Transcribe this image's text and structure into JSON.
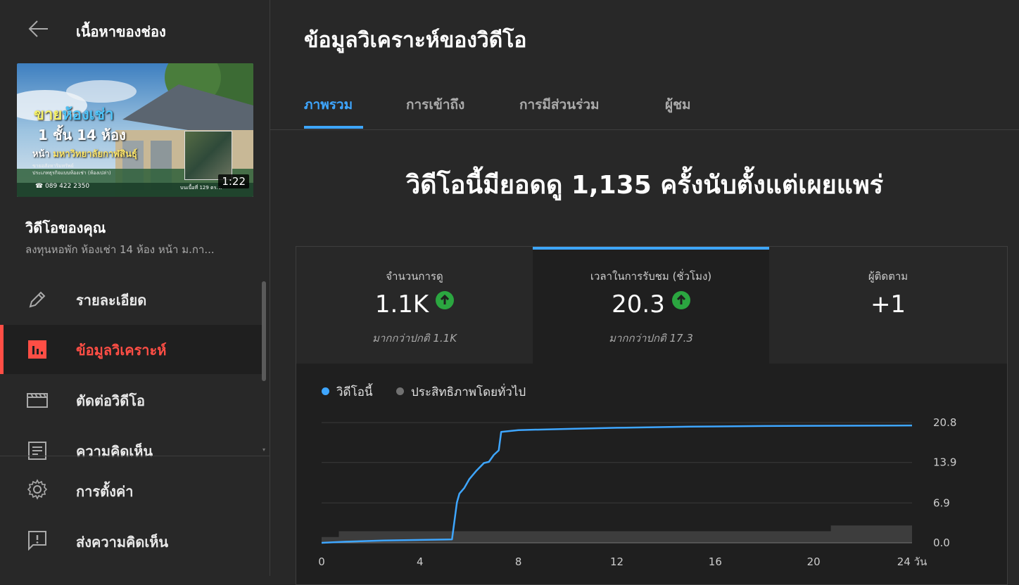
{
  "sidebar": {
    "title": "เนื้อหาของช่อง",
    "thumbnail": {
      "line1_a": "ขาย",
      "line1_b": "ห้องเช่า",
      "line2": "1 ชั้น 14 ห้อง",
      "line3_a": "หน้า ",
      "line3_b": "มหาวิทยาลัยกาฬสินธุ์",
      "small1": "ขายอสังหาริมทรัพย์",
      "small2": "ประเภทธุรกิจแบบห้องเช่า (ห้องเปล่า)",
      "phone": "☎ 089 422 2350",
      "map_label": "บนเนื้อที่ 129 ตร.ว.",
      "duration": "1:22"
    },
    "your_video": "วิดีโอของคุณ",
    "video_name": "ลงทุนหอพัก ห้องเช่า 14 ห้อง หน้า ม.กา...",
    "nav": [
      {
        "label": "รายละเอียด",
        "icon": "pencil-icon"
      },
      {
        "label": "ข้อมูลวิเคราะห์",
        "icon": "analytics-icon"
      },
      {
        "label": "ตัดต่อวิดีโอ",
        "icon": "editor-icon"
      },
      {
        "label": "ความคิดเห็น",
        "icon": "comments-icon"
      }
    ],
    "bottom": [
      {
        "label": "การตั้งค่า",
        "icon": "gear-icon"
      },
      {
        "label": "ส่งความคิดเห็น",
        "icon": "feedback-icon"
      }
    ]
  },
  "main": {
    "title": "ข้อมูลวิเคราะห์ของวิดีโอ",
    "tabs": [
      "ภาพรวม",
      "การเข้าถึง",
      "การมีส่วนร่วม",
      "ผู้ชม"
    ],
    "headline": "วิดีโอนี้มียอดดู 1,135 ครั้งนับตั้งแต่เผยแพร่",
    "metrics": [
      {
        "label": "จำนวนการดู",
        "value": "1.1K",
        "note": "มากกว่าปกติ 1.1K"
      },
      {
        "label": "เวลาในการรับชม (ชั่วโมง)",
        "value": "20.3",
        "note": "มากกว่าปกติ 17.3"
      },
      {
        "label": "ผู้ติดตาม",
        "value": "+1",
        "note": ""
      }
    ],
    "legend": {
      "this_video": "วิดีโอนี้",
      "typical": "ประสิทธิภาพโดยทั่วไป"
    },
    "colors": {
      "accent": "#3ea6ff",
      "active_nav": "#ff4e45",
      "up": "#2ba640",
      "series": "#3ea6ff",
      "typical": "#3d3d3d"
    }
  },
  "chart_data": {
    "type": "line",
    "x_ticks": [
      "0",
      "4",
      "8",
      "12",
      "16",
      "20",
      "24 วัน"
    ],
    "y_ticks": [
      "0.0",
      "6.9",
      "13.9",
      "20.8"
    ],
    "xlim": [
      0,
      24
    ],
    "ylim": [
      0,
      20.8
    ],
    "series": [
      {
        "name": "วิดีโอนี้",
        "points": [
          [
            0,
            0
          ],
          [
            1,
            0.2
          ],
          [
            2.5,
            0.4
          ],
          [
            4,
            0.5
          ],
          [
            5.3,
            0.6
          ],
          [
            5.5,
            7
          ],
          [
            5.6,
            8.5
          ],
          [
            5.8,
            9.5
          ],
          [
            6,
            11
          ],
          [
            6.3,
            12.5
          ],
          [
            6.6,
            13.8
          ],
          [
            6.8,
            14
          ],
          [
            7,
            15.2
          ],
          [
            7.2,
            16
          ],
          [
            7.3,
            19.2
          ],
          [
            8,
            19.5
          ],
          [
            10,
            19.7
          ],
          [
            12,
            19.9
          ],
          [
            15,
            20.1
          ],
          [
            18,
            20.2
          ],
          [
            24,
            20.3
          ]
        ]
      },
      {
        "name": "ประสิทธิภาพโดยทั่วไป",
        "band": true,
        "points": [
          [
            0,
            1
          ],
          [
            0.7,
            1
          ],
          [
            0.7,
            2
          ],
          [
            20.7,
            2
          ],
          [
            20.7,
            3
          ],
          [
            24,
            3
          ]
        ]
      }
    ]
  }
}
